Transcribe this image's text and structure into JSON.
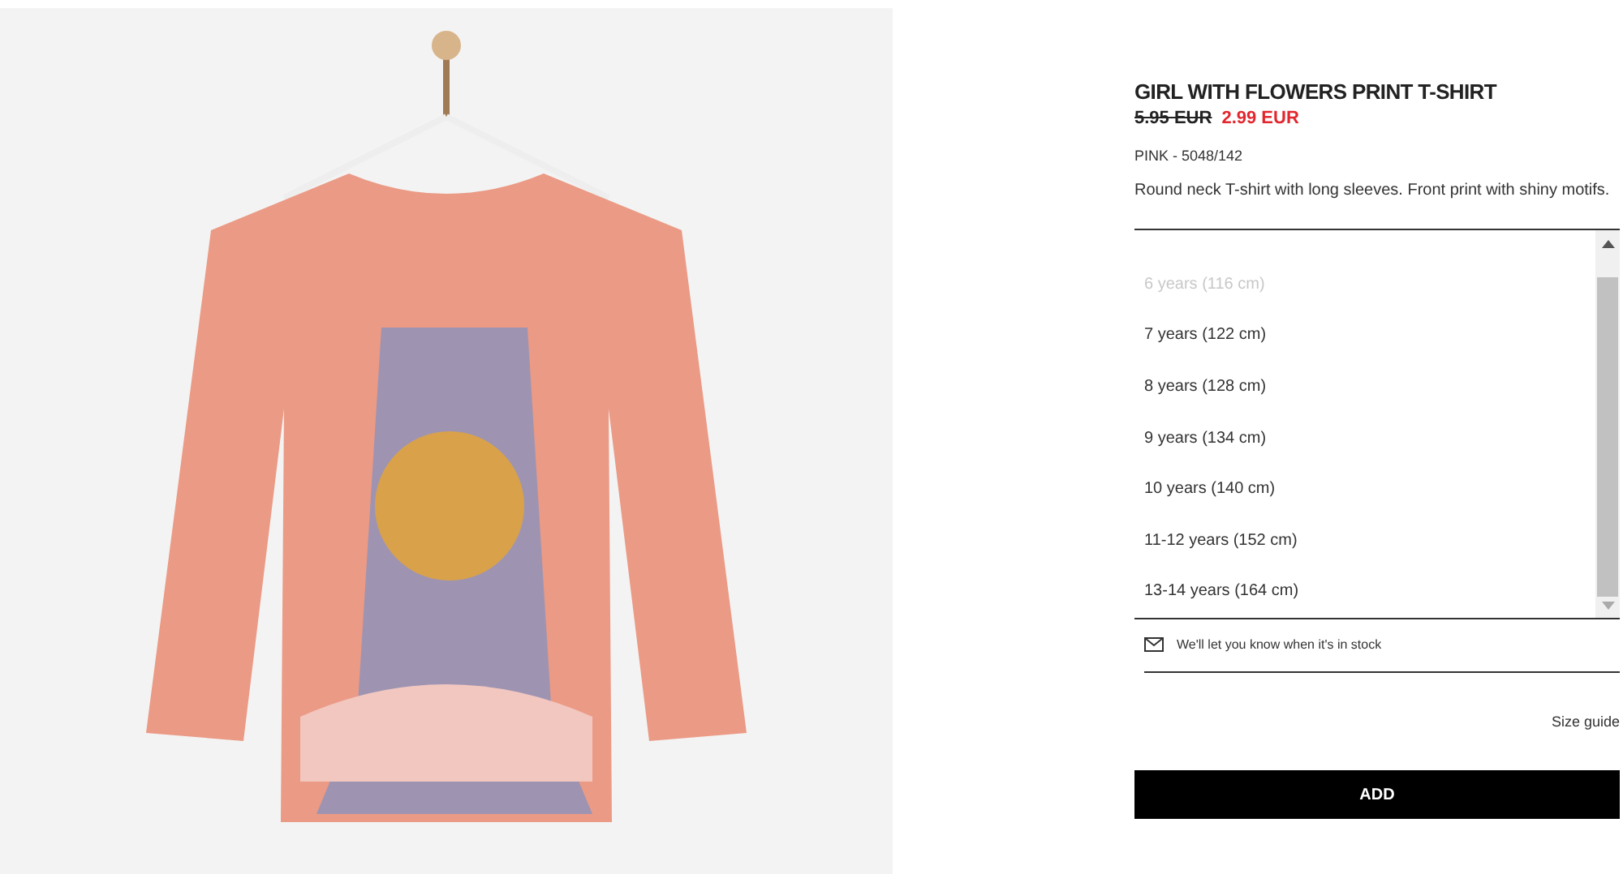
{
  "product": {
    "title": "GIRL WITH FLOWERS PRINT T-SHIRT",
    "old_price": "5.95 EUR",
    "price": "2.99 EUR",
    "color_ref": "PINK - 5048/142",
    "description": "Round neck T-shirt with long sleeves. Front print with shiny motifs."
  },
  "sizes": [
    {
      "label": "6 years (116 cm)",
      "disabled": true
    },
    {
      "label": "7 years (122 cm)",
      "disabled": false
    },
    {
      "label": "8 years (128 cm)",
      "disabled": false
    },
    {
      "label": "9 years (134 cm)",
      "disabled": false
    },
    {
      "label": "10 years (140 cm)",
      "disabled": false
    },
    {
      "label": "11-12 years (152 cm)",
      "disabled": false
    },
    {
      "label": "13-14 years (164 cm)",
      "disabled": false
    }
  ],
  "stock_notice": "We'll let you know when it's in stock",
  "size_guide": "Size guide",
  "add_button": "ADD"
}
